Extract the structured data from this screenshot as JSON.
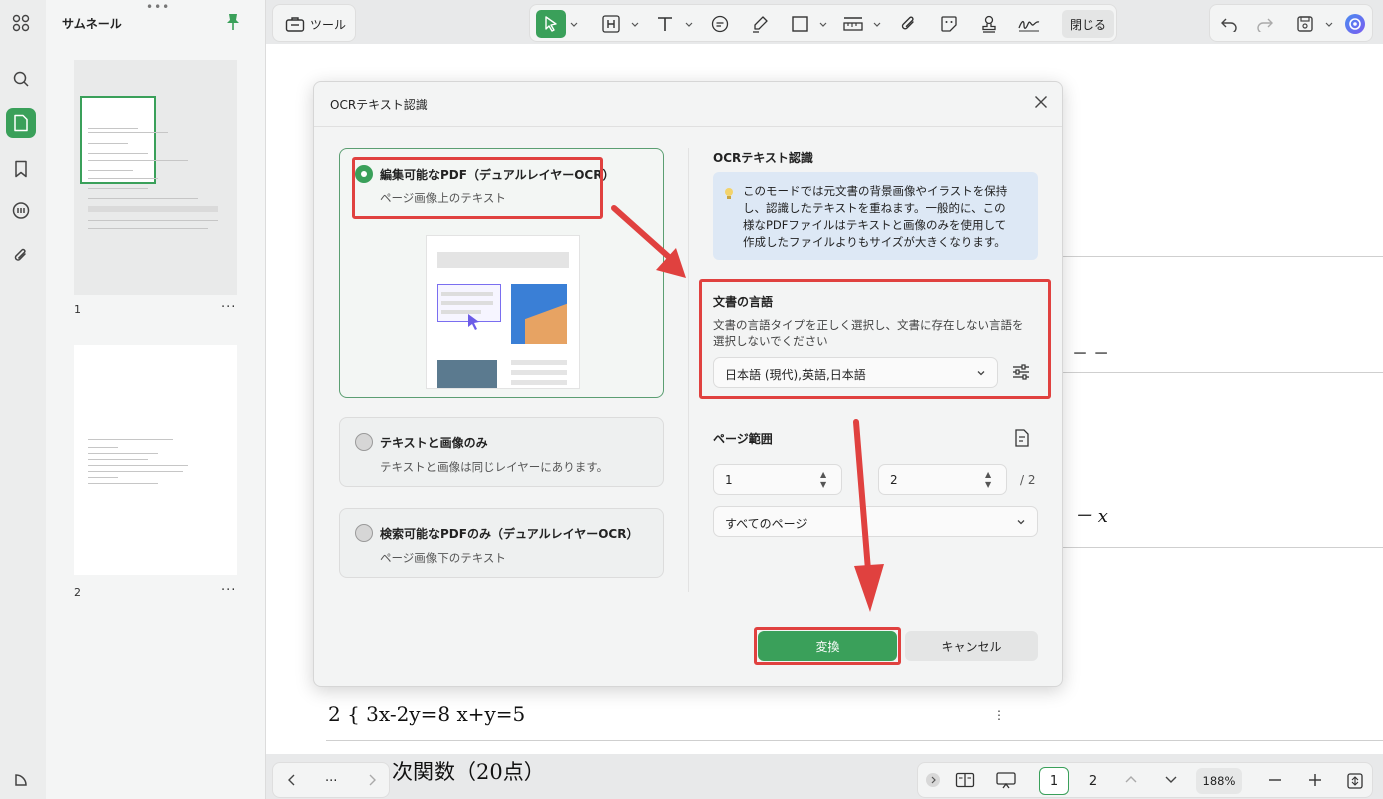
{
  "app": {
    "thumbnail_panel_title": "サムネール",
    "tool_button_label": "ツール",
    "close_button_label": "閉じる"
  },
  "thumbnails": [
    {
      "page": "1"
    },
    {
      "page": "2"
    }
  ],
  "document": {
    "equation_line": "2 { 3x-2y=8 x+y=5",
    "heading_partial": "次関数（20点）",
    "fragment_1": "－ －",
    "fragment_2": "－ x"
  },
  "dialog": {
    "title": "OCRテキスト認識",
    "options": [
      {
        "title": "編集可能なPDF（デュアルレイヤーOCR）",
        "desc": "ページ画像上のテキスト",
        "selected": true
      },
      {
        "title": "テキストと画像のみ",
        "desc": "テキストと画像は同じレイヤーにあります。",
        "selected": false
      },
      {
        "title": "検索可能なPDFのみ（デュアルレイヤーOCR）",
        "desc": "ページ画像下のテキスト",
        "selected": false
      }
    ],
    "right_title": "OCRテキスト認識",
    "info_text": "このモードでは元文書の背景画像やイラストを保持し、認識したテキストを重ねます。一般的に、この様なPDFファイルはテキストと画像のみを使用して作成したファイルよりもサイズが大きくなります。",
    "info_lines": [
      "このモードでは元文書の背景画像やイラストを保持",
      "し、認識したテキストを重ねます。一般的に、この",
      "様なPDFファイルはテキストと画像のみを使用して",
      "作成したファイルよりもサイズが大きくなります。"
    ],
    "language_heading": "文書の言語",
    "language_hint_lines": [
      "文書の言語タイプを正しく選択し、文書に存在しない言語を",
      "選択しないでください"
    ],
    "language_value": "日本語 (現代),英語,日本語",
    "page_range_heading": "ページ範囲",
    "page_from": "1",
    "page_to": "2",
    "page_total": "/ 2",
    "page_scope": "すべてのページ",
    "convert_label": "変換",
    "cancel_label": "キャンセル"
  },
  "bottom": {
    "page_current": "1",
    "page_next": "2",
    "zoom": "188%",
    "more": "..."
  },
  "colors": {
    "accent": "#3aa05a",
    "annotation_red": "#e0413f",
    "info_bg": "#dde8f5"
  }
}
